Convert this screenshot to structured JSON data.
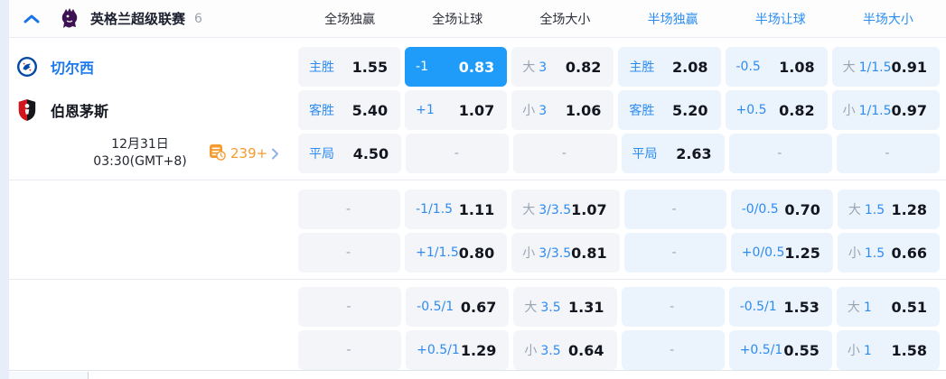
{
  "header": {
    "league": "英格兰超级联赛",
    "count": "6",
    "columns": [
      {
        "label": "全场独赢",
        "section": "full"
      },
      {
        "label": "全场让球",
        "section": "full"
      },
      {
        "label": "全场大小",
        "section": "full"
      },
      {
        "label": "半场独赢",
        "section": "half"
      },
      {
        "label": "半场让球",
        "section": "half"
      },
      {
        "label": "半场大小",
        "section": "half"
      }
    ],
    "icons": {
      "collapse": "chevron-up-icon",
      "league_logo": "premier-league-lion-icon"
    }
  },
  "match": {
    "home": {
      "name": "切尔西",
      "crest": "chelsea-crest-icon"
    },
    "away": {
      "name": "伯恩茅斯",
      "crest": "bournemouth-crest-icon"
    },
    "date_line1": "12月31日",
    "date_line2": "03:30(GMT+8)",
    "markets_count": "239+",
    "markets_icon": "stats-clock-icon"
  },
  "rows": [
    [
      {
        "kind": "win",
        "label": "主胜",
        "value": "1.55"
      },
      {
        "kind": "handicap",
        "label": "-1",
        "value": "0.83",
        "highlight": true
      },
      {
        "kind": "ou",
        "ou": "大",
        "line": "3",
        "value": "0.82"
      },
      {
        "kind": "win",
        "label": "主胜",
        "value": "2.08"
      },
      {
        "kind": "handicap",
        "label": "-0.5",
        "value": "1.08"
      },
      {
        "kind": "ou",
        "ou": "大",
        "line": "1/1.5",
        "value": "0.91"
      }
    ],
    [
      {
        "kind": "win",
        "label": "客胜",
        "value": "5.40"
      },
      {
        "kind": "handicap",
        "label": "+1",
        "value": "1.07"
      },
      {
        "kind": "ou",
        "ou": "小",
        "line": "3",
        "value": "1.06"
      },
      {
        "kind": "win",
        "label": "客胜",
        "value": "5.20"
      },
      {
        "kind": "handicap",
        "label": "+0.5",
        "value": "0.82"
      },
      {
        "kind": "ou",
        "ou": "小",
        "line": "1/1.5",
        "value": "0.97"
      }
    ],
    [
      {
        "kind": "win",
        "label": "平局",
        "value": "4.50"
      },
      {
        "kind": "dash",
        "label": "-"
      },
      {
        "kind": "dash",
        "label": "-"
      },
      {
        "kind": "win",
        "label": "平局",
        "value": "2.63"
      },
      {
        "kind": "dash",
        "label": "-"
      },
      {
        "kind": "dash",
        "label": "-"
      }
    ],
    [
      {
        "kind": "dash",
        "label": "-"
      },
      {
        "kind": "handicap",
        "label": "-1/1.5",
        "value": "1.11"
      },
      {
        "kind": "ou",
        "ou": "大",
        "line": "3/3.5",
        "value": "1.07"
      },
      {
        "kind": "dash",
        "label": "-"
      },
      {
        "kind": "handicap",
        "label": "-0/0.5",
        "value": "0.70"
      },
      {
        "kind": "ou",
        "ou": "大",
        "line": "1.5",
        "value": "1.28"
      }
    ],
    [
      {
        "kind": "dash",
        "label": "-"
      },
      {
        "kind": "handicap",
        "label": "+1/1.5",
        "value": "0.80"
      },
      {
        "kind": "ou",
        "ou": "小",
        "line": "3/3.5",
        "value": "0.81"
      },
      {
        "kind": "dash",
        "label": "-"
      },
      {
        "kind": "handicap",
        "label": "+0/0.5",
        "value": "1.25"
      },
      {
        "kind": "ou",
        "ou": "小",
        "line": "1.5",
        "value": "0.66"
      }
    ],
    [
      {
        "kind": "dash",
        "label": "-"
      },
      {
        "kind": "handicap",
        "label": "-0.5/1",
        "value": "0.67"
      },
      {
        "kind": "ou",
        "ou": "大",
        "line": "3.5",
        "value": "1.31"
      },
      {
        "kind": "dash",
        "label": "-"
      },
      {
        "kind": "handicap",
        "label": "-0.5/1",
        "value": "1.53"
      },
      {
        "kind": "ou",
        "ou": "大",
        "line": "1",
        "value": "0.51"
      }
    ],
    [
      {
        "kind": "dash",
        "label": "-"
      },
      {
        "kind": "handicap",
        "label": "+0.5/1",
        "value": "1.29"
      },
      {
        "kind": "ou",
        "ou": "小",
        "line": "3.5",
        "value": "0.64"
      },
      {
        "kind": "dash",
        "label": "-"
      },
      {
        "kind": "handicap",
        "label": "+0.5/1",
        "value": "0.55"
      },
      {
        "kind": "ou",
        "ou": "小",
        "line": "1",
        "value": "1.58"
      }
    ]
  ],
  "row_tops": [
    52,
    100,
    148,
    210,
    258,
    318,
    366
  ],
  "colors": {
    "accent_blue": "#2e8bf0",
    "header_half_blue": "#2a8df2",
    "highlight_cell": "#1f9cf9",
    "cell_full_bg": "#f3f5f9",
    "cell_half_bg": "#ebf4fd",
    "value_dark": "#14161f",
    "ou_gray": "#9aa4b2",
    "orange": "#f79b2e",
    "home_name_blue": "#1d79f3",
    "league_purple": "#3d1152"
  }
}
